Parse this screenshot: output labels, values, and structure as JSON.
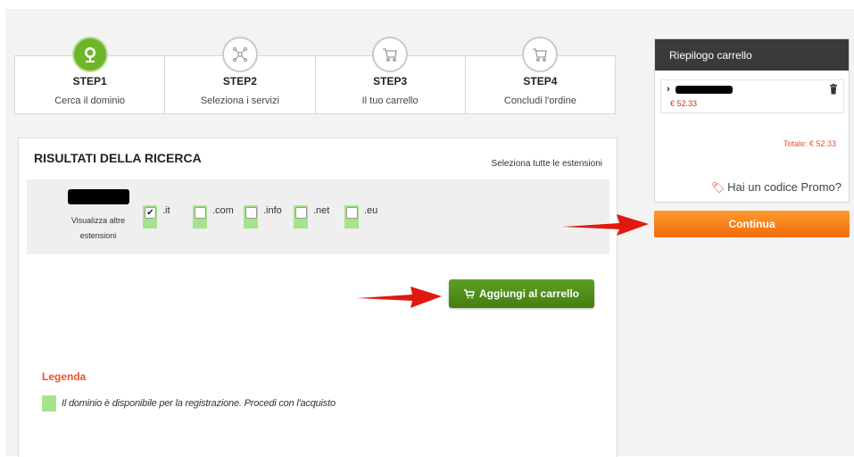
{
  "steps": [
    {
      "title": "STEP1",
      "subtitle": "Cerca il dominio",
      "icon": "globe-icon",
      "active": true
    },
    {
      "title": "STEP2",
      "subtitle": "Seleziona i servizi",
      "icon": "network-icon",
      "active": false
    },
    {
      "title": "STEP3",
      "subtitle": "Il tuo carrello",
      "icon": "cart-icon",
      "active": false
    },
    {
      "title": "STEP4",
      "subtitle": "Concludi l'ordine",
      "icon": "cart-icon",
      "active": false
    }
  ],
  "results": {
    "title": "RISULTATI DELLA RICERCA",
    "select_all": "Seleziona tutte le estensioni",
    "more_extensions": "Visualizza altre estensioni",
    "extensions": [
      {
        "label": ".it",
        "checked": true
      },
      {
        "label": ".com",
        "checked": false
      },
      {
        "label": ".info",
        "checked": false
      },
      {
        "label": ".net",
        "checked": false
      },
      {
        "label": ".eu",
        "checked": false
      }
    ],
    "add_to_cart": "Aggiungi al carrello",
    "legend_title": "Legenda",
    "legend_text": "Il dominio è disponibile per la registrazione. Procedi con l'acquisto"
  },
  "cart": {
    "header": "Riepilogo carrello",
    "item_price": "€ 52.33",
    "total": "Totale: € 52.33",
    "promo": "Hai un codice Promo?",
    "continue": "Continua"
  },
  "colors": {
    "active_step": "#6fb52b",
    "available": "#a6e38c",
    "add_button": "#4e8c1a",
    "continue_button": "#f7811b",
    "arrow": "#e0190f",
    "accent_text": "#e8542b"
  }
}
